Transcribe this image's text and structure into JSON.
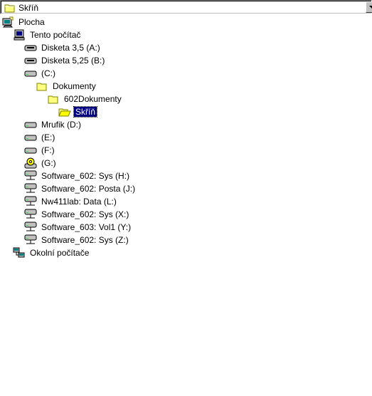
{
  "combo": {
    "value": "Skříň",
    "icon": "folder-icon"
  },
  "tree": [
    {
      "label": "Plocha",
      "icon": "desktop-icon",
      "level": 0
    },
    {
      "label": "Tento počítač",
      "icon": "my-computer-icon",
      "level": 1
    },
    {
      "label": "Disketa 3,5 (A:)",
      "icon": "floppy-drive-icon",
      "level": 2
    },
    {
      "label": "Disketa 5,25 (B:)",
      "icon": "floppy-drive-icon",
      "level": 2
    },
    {
      "label": "(C:)",
      "icon": "hard-drive-icon",
      "level": 2
    },
    {
      "label": "Dokumenty",
      "icon": "folder-icon",
      "level": 3
    },
    {
      "label": "602Dokumenty",
      "icon": "folder-icon",
      "level": 4
    },
    {
      "label": "Skříň",
      "icon": "open-folder-icon",
      "level": 5,
      "selected": true
    },
    {
      "label": "Mrufik (D:)",
      "icon": "hard-drive-icon",
      "level": 2
    },
    {
      "label": "(E:)",
      "icon": "hard-drive-icon",
      "level": 2
    },
    {
      "label": "(F:)",
      "icon": "hard-drive-icon",
      "level": 2
    },
    {
      "label": "(G:)",
      "icon": "cd-drive-icon",
      "level": 2
    },
    {
      "label": "Software_602: Sys (H:)",
      "icon": "network-drive-icon",
      "level": 2
    },
    {
      "label": "Software_602: Posta (J:)",
      "icon": "network-drive-icon",
      "level": 2
    },
    {
      "label": "Nw411lab: Data (L:)",
      "icon": "network-drive-icon",
      "level": 2
    },
    {
      "label": "Software_602: Sys (X:)",
      "icon": "network-drive-icon",
      "level": 2
    },
    {
      "label": "Software_603: Vol1 (Y:)",
      "icon": "network-drive-icon",
      "level": 2
    },
    {
      "label": "Software_602: Sys (Z:)",
      "icon": "network-drive-icon",
      "level": 2
    },
    {
      "label": "Okolní počítače",
      "icon": "network-neighborhood-icon",
      "level": 1
    }
  ]
}
